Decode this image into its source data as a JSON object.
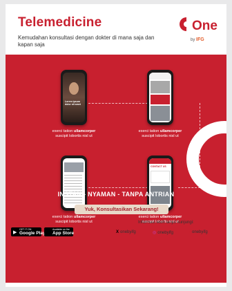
{
  "header": {
    "title": "Telemedicine",
    "subtitle": "Kemudahan konsultasi dengan dokter di mana saja dan kapan saja",
    "logo_text": "One",
    "logo_sub_prefix": "by",
    "logo_sub_brand": "IFG"
  },
  "phones": [
    {
      "caption_prefix": "exerci tation ",
      "caption_bold": "ullamcorper",
      "caption_suffix": "suscipit lobortis nisl ut",
      "screen_text": "Lorem ipsum dolor sit amet"
    },
    {
      "caption_prefix": "exerci tation ",
      "caption_bold": "ullamcorper",
      "caption_suffix": "suscipit lobortis nisl ut",
      "screen_text": ""
    },
    {
      "caption_prefix": "exerci tation ",
      "caption_bold": "ullamcorper",
      "caption_suffix": "suscipit lobortis nisl ut",
      "screen_text": ""
    },
    {
      "caption_prefix": "exerci tation ",
      "caption_bold": "ullamcorper",
      "caption_suffix": "suscipit lobortis nisl ut",
      "screen_text": "CONTACT US"
    }
  ],
  "tagline": "INSTAN - NYAMAN - TANPA ANTRIAN",
  "cta_label": "Yuk, Konsultasikan Sekarang!",
  "footer": {
    "download_label": "Download Sekarang",
    "google_play_small": "GET IT ON",
    "google_play": "Google Play",
    "app_store_small": "Available on the",
    "app_store": "App Store",
    "info_label": "Informasi lebih lanjut kunjungi:",
    "social": [
      {
        "icon": "x-icon",
        "glyph": "X",
        "handle": "onebyifg",
        "color": "#000000"
      },
      {
        "icon": "instagram-icon",
        "glyph": "◎",
        "handle": "onebyifg",
        "color": "#c13584"
      },
      {
        "icon": "facebook-icon",
        "glyph": "f",
        "handle": "onebyifg",
        "color": "#c8202f"
      }
    ]
  },
  "colors": {
    "brand_red": "#c8202f",
    "cta_bg": "#e8d9c9"
  }
}
